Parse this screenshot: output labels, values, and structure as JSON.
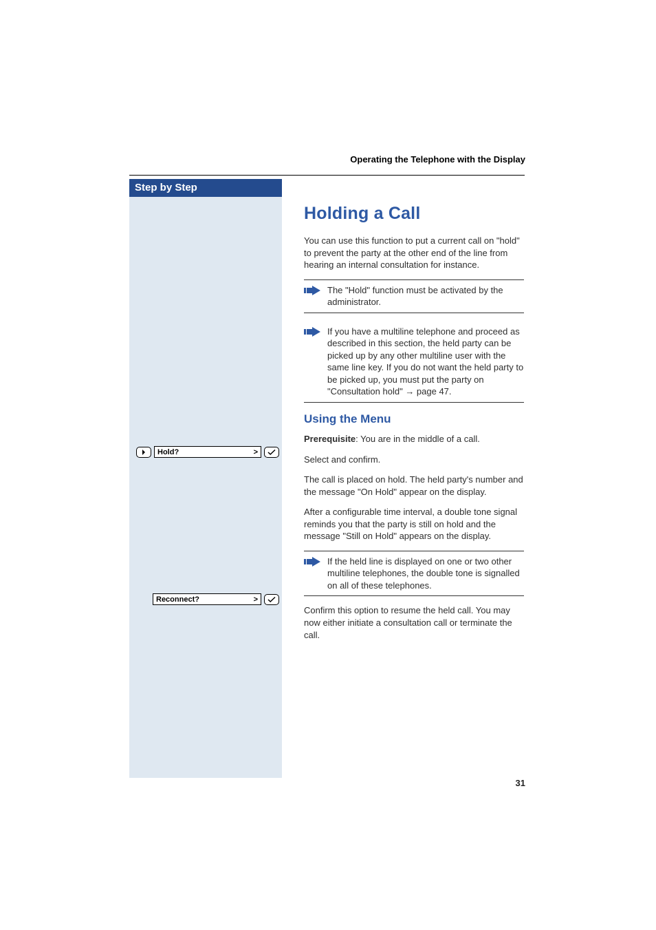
{
  "runningHead": "Operating the Telephone with the Display",
  "sidebar": {
    "title": "Step by Step",
    "steps": [
      {
        "display": "Hold?"
      },
      {
        "display": "Reconnect?"
      }
    ]
  },
  "h1": "Holding a Call",
  "intro": "You can use this function to put a current call on \"hold\" to prevent the party at the other end of the line from hearing an internal consultation for instance.",
  "note1": "The \"Hold\" function must be activated by the administrator.",
  "note2_pre": "If you have a multiline telephone and proceed as described in this section, the held party can be picked up by any other multiline user with the same line key. If you do not want the held party to be picked up, you must put the party on \"Consultation hold\" ",
  "note2_xref": "→ page 47.",
  "h2": "Using the Menu",
  "prereq_label": "Prerequisite",
  "prereq_text": ": You are in the middle of a call.",
  "step1_action": "Select and confirm.",
  "step1_result": "The call is placed on hold. The held party's number and the message \"On Hold\" appear on the display.",
  "step1_after": "After a configurable time interval, a double tone signal reminds you that the party is still on hold and the message \"Still on Hold\" appears on the display.",
  "note3": "If the held line is displayed on one or two other multiline telephones, the double tone is signalled on all of these telephones.",
  "step2_action": "Confirm this option to resume the held call. You may now either initiate a consultation call or terminate the call.",
  "pageNumber": "31",
  "icons": {
    "nav": "nav-right-icon",
    "ok": "check-icon",
    "chev": ">",
    "note": "note-arrow-icon"
  }
}
